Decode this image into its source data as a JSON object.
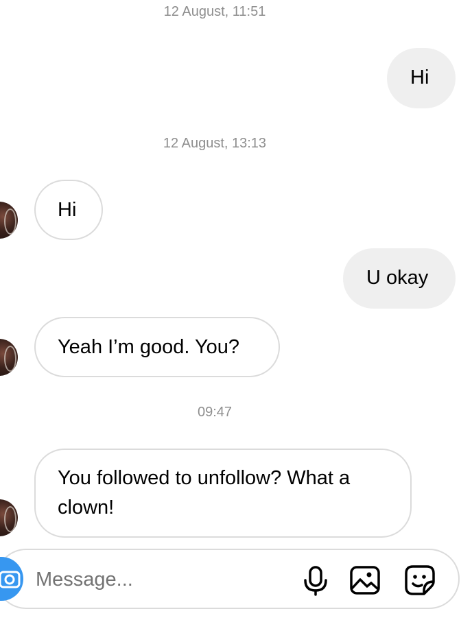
{
  "thread": {
    "timestamps": {
      "t1": "12 August, 11:51",
      "t2": "12 August, 13:13",
      "t3": "09:47"
    },
    "messages": {
      "m1": {
        "direction": "outgoing",
        "text": "Hi"
      },
      "m2": {
        "direction": "incoming",
        "text": "Hi"
      },
      "m3": {
        "direction": "outgoing",
        "text": "U okay"
      },
      "m4": {
        "direction": "incoming",
        "text": "Yeah I’m good. You?"
      },
      "m5": {
        "direction": "incoming",
        "line1": "You followed to unfollow? What a",
        "line2": "clown!"
      }
    }
  },
  "composer": {
    "placeholder": "Message...",
    "value": "",
    "icons": [
      "camera-icon",
      "microphone-icon",
      "gallery-icon",
      "sticker-icon"
    ]
  },
  "colors": {
    "outgoing_bubble": "#efefef",
    "incoming_border": "#dbdbdb",
    "timestamp": "#8e8e8e",
    "accent": "#3797f0"
  }
}
